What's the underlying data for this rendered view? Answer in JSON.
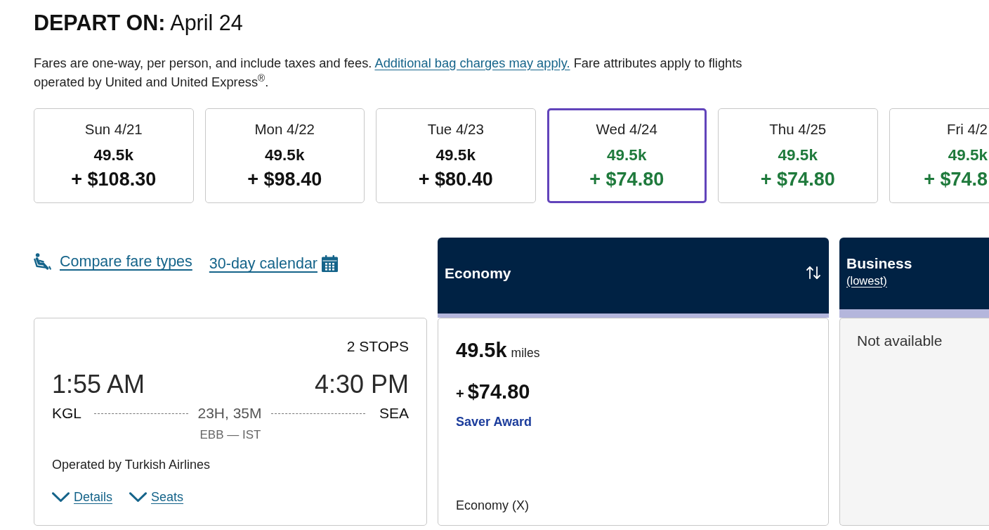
{
  "heading": "**DEPART ON:** April 24",
  "fare_note": {
    "text_before": "Fares are one-way, per person, and include taxes and fees.",
    "link": "Additional bag charges may apply.",
    "text_after": "Fare attributes apply to flights operated by United and United Express$^{®}$."
  },
  "date_cards": [
    {
      "day": "Sun 4/21",
      "miles": "49.5k",
      "price": "+ $108.30",
      "selected": false,
      "lowest": false
    },
    {
      "day": "Mon 4/22",
      "miles": "49.5k",
      "price": "+ $98.40",
      "selected": false,
      "lowest": false
    },
    {
      "day": "Tue 4/23",
      "miles": "49.5k",
      "price": "+ $80.40",
      "selected": false,
      "lowest": false
    },
    {
      "day": "Wed 4/24",
      "miles": "49.5k",
      "price": "+ $74.80",
      "selected": true,
      "lowest": true
    },
    {
      "day": "Thu 4/25",
      "miles": "49.5k",
      "price": "+ $74.80",
      "selected": false,
      "lowest": true
    },
    {
      "day": "Fri 4/2",
      "miles": "49.5k",
      "price": "+ $74.8",
      "selected": false,
      "lowest": true
    }
  ],
  "links": {
    "compare_fare_types": "Compare fare types",
    "calendar": "30-day calendar"
  },
  "cabins": [
    {
      "name": "Economy",
      "sort_button": true
    },
    {
      "name": "Business",
      "link": "(lowest)",
      "sort_button": false
    }
  ],
  "flight": {
    "stops": "2 STOPS",
    "depart_time": "1:55 AM",
    "arrive_time": "4:30 PM",
    "origin": "KGL",
    "destination": "SEA",
    "duration": "23H, 35M",
    "connections": "EBB — IST",
    "operator": "Operated by Turkish Airlines",
    "actions": [
      "Details",
      "Seats"
    ]
  },
  "fares": [
    {
      "kind": "fare",
      "miles": "49.5k",
      "unit": "miles",
      "plus": "+",
      "price": "$74.80",
      "fare_type": "Saver Award",
      "cabin_code": "Economy (X)"
    },
    {
      "kind": "unavailable",
      "message": "Not available"
    }
  ]
}
